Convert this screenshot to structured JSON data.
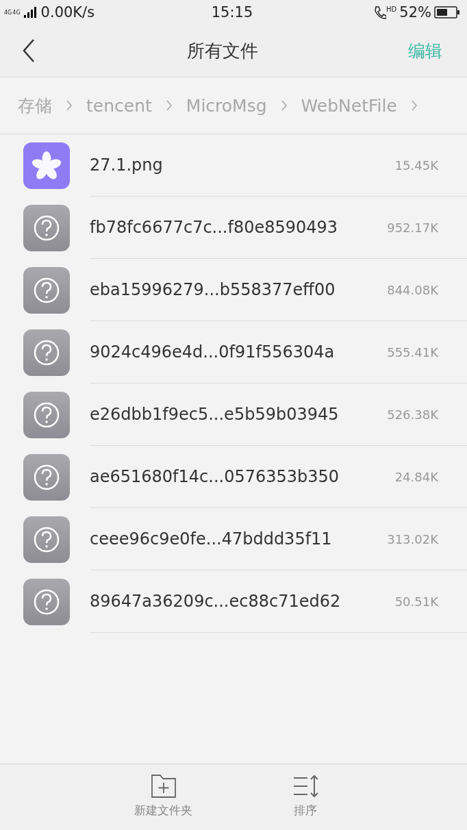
{
  "status_bar": {
    "network": [
      "4G",
      "4G"
    ],
    "speed": "0.00K/s",
    "time": "15:15",
    "call_badge": "HD",
    "battery": "52%"
  },
  "header": {
    "title": "所有文件",
    "action": "编辑"
  },
  "breadcrumb": [
    {
      "label": "存储"
    },
    {
      "label": "tencent"
    },
    {
      "label": "MicroMsg"
    },
    {
      "label": "WebNetFile"
    }
  ],
  "files": [
    {
      "kind": "image",
      "name": "27.1.png",
      "size": "15.45K"
    },
    {
      "kind": "unknown",
      "name": "fb78fc6677c7c...f80e8590493",
      "size": "952.17K"
    },
    {
      "kind": "unknown",
      "name": "eba15996279...b558377eff00",
      "size": "844.08K"
    },
    {
      "kind": "unknown",
      "name": "9024c496e4d...0f91f556304a",
      "size": "555.41K"
    },
    {
      "kind": "unknown",
      "name": "e26dbb1f9ec5...e5b59b03945",
      "size": "526.38K"
    },
    {
      "kind": "unknown",
      "name": "ae651680f14c...0576353b350",
      "size": "24.84K"
    },
    {
      "kind": "unknown",
      "name": "ceee96c9e0fe...47bddd35f11",
      "size": "313.02K"
    },
    {
      "kind": "unknown",
      "name": "89647a36209c...ec88c71ed62",
      "size": "50.51K"
    }
  ],
  "toolbar": [
    {
      "kind": "new-folder",
      "label": "新建文件夹"
    },
    {
      "kind": "sort",
      "label": "排序"
    }
  ]
}
